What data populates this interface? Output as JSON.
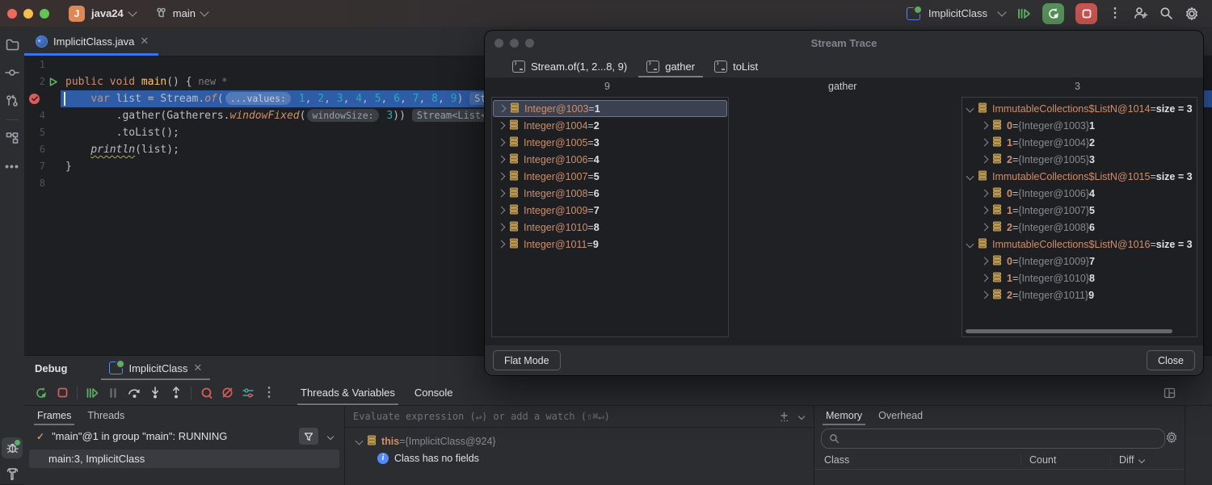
{
  "colors": {
    "accent": "#3574f0",
    "exec-line": "#2e5ca6",
    "orange": "#cf8e6d",
    "cyan": "#2aacb8",
    "green": "#5fad65",
    "red": "#db5c5c"
  },
  "titlebar": {
    "project": "java24",
    "branch": "main",
    "run_config": "ImplicitClass",
    "project_badge": "J"
  },
  "editor": {
    "tab_title": "ImplicitClass.java",
    "lines": [
      {
        "n": "1",
        "segs": []
      },
      {
        "n": "2",
        "run": true,
        "segs": [
          {
            "t": "public void ",
            "c": "kw"
          },
          {
            "t": "main",
            "c": "fn"
          },
          {
            "t": "() { ",
            "c": "pl"
          },
          {
            "t": "new *",
            "c": "hint"
          }
        ]
      },
      {
        "n": "3",
        "bp": true,
        "hl": true,
        "segs": [
          {
            "t": "    ",
            "c": "pl"
          },
          {
            "t": "var",
            "c": "kw"
          },
          {
            "t": " list = Stream.",
            "c": "pl"
          },
          {
            "t": "of",
            "c": "kwi"
          },
          {
            "t": "(",
            "c": "pl"
          },
          {
            "t": "...values:",
            "c": "pill"
          },
          {
            "t": " ",
            "c": "pl"
          },
          {
            "t": "1",
            "c": "num"
          },
          {
            "t": ", ",
            "c": "pl"
          },
          {
            "t": "2",
            "c": "num"
          },
          {
            "t": ", ",
            "c": "pl"
          },
          {
            "t": "3",
            "c": "num"
          },
          {
            "t": ", ",
            "c": "pl"
          },
          {
            "t": "4",
            "c": "num"
          },
          {
            "t": ", ",
            "c": "pl"
          },
          {
            "t": "5",
            "c": "num"
          },
          {
            "t": ", ",
            "c": "pl"
          },
          {
            "t": "6",
            "c": "num"
          },
          {
            "t": ", ",
            "c": "pl"
          },
          {
            "t": "7",
            "c": "num"
          },
          {
            "t": ", ",
            "c": "pl"
          },
          {
            "t": "8",
            "c": "num"
          },
          {
            "t": ", ",
            "c": "pl"
          },
          {
            "t": "9",
            "c": "num"
          },
          {
            "t": ") ",
            "c": "pl"
          },
          {
            "t": "Stream<Integer>",
            "c": "type"
          }
        ]
      },
      {
        "n": "4",
        "segs": [
          {
            "t": "        .gather(Gatherers.",
            "c": "pl"
          },
          {
            "t": "windowFixed",
            "c": "kwi"
          },
          {
            "t": "(",
            "c": "pl"
          },
          {
            "t": "windowSize:",
            "c": "pill"
          },
          {
            "t": " ",
            "c": "pl"
          },
          {
            "t": "3",
            "c": "num"
          },
          {
            "t": ")) ",
            "c": "pl"
          },
          {
            "t": "Stream<List<...>>",
            "c": "type"
          }
        ]
      },
      {
        "n": "5",
        "segs": [
          {
            "t": "        .toList();",
            "c": "pl"
          }
        ]
      },
      {
        "n": "6",
        "segs": [
          {
            "t": "    ",
            "c": "pl"
          },
          {
            "t": "println",
            "c": "warn"
          },
          {
            "t": "(list);",
            "c": "pl"
          }
        ]
      },
      {
        "n": "7",
        "segs": [
          {
            "t": "}",
            "c": "pl"
          }
        ]
      },
      {
        "n": "8",
        "segs": []
      }
    ]
  },
  "dialog": {
    "title": "Stream Trace",
    "tabs": [
      {
        "label": "Stream.of(1, 2...8, 9)"
      },
      {
        "label": "gather"
      },
      {
        "label": "toList"
      }
    ],
    "before_count": "9",
    "operation": "gather",
    "after_count": "3",
    "before": [
      {
        "name": "Integer@1003",
        "value": "1",
        "selected": true
      },
      {
        "name": "Integer@1004",
        "value": "2"
      },
      {
        "name": "Integer@1005",
        "value": "3"
      },
      {
        "name": "Integer@1006",
        "value": "4"
      },
      {
        "name": "Integer@1007",
        "value": "5"
      },
      {
        "name": "Integer@1008",
        "value": "6"
      },
      {
        "name": "Integer@1009",
        "value": "7"
      },
      {
        "name": "Integer@1010",
        "value": "8"
      },
      {
        "name": "Integer@1011",
        "value": "9"
      }
    ],
    "after": [
      {
        "name": "ImmutableCollections$ListN@1014",
        "value": "size = 3",
        "children": [
          {
            "index": "0",
            "ref": "{Integer@1003}",
            "value": "1"
          },
          {
            "index": "1",
            "ref": "{Integer@1004}",
            "value": "2"
          },
          {
            "index": "2",
            "ref": "{Integer@1005}",
            "value": "3"
          }
        ]
      },
      {
        "name": "ImmutableCollections$ListN@1015",
        "value": "size = 3",
        "children": [
          {
            "index": "0",
            "ref": "{Integer@1006}",
            "value": "4"
          },
          {
            "index": "1",
            "ref": "{Integer@1007}",
            "value": "5"
          },
          {
            "index": "2",
            "ref": "{Integer@1008}",
            "value": "6"
          }
        ]
      },
      {
        "name": "ImmutableCollections$ListN@1016",
        "value": "size = 3",
        "children": [
          {
            "index": "0",
            "ref": "{Integer@1009}",
            "value": "7"
          },
          {
            "index": "1",
            "ref": "{Integer@1010}",
            "value": "8"
          },
          {
            "index": "2",
            "ref": "{Integer@1011}",
            "value": "9"
          }
        ]
      }
    ],
    "flat_mode_label": "Flat Mode",
    "close_label": "Close"
  },
  "debug": {
    "title": "Debug",
    "session_tab": "ImplicitClass",
    "view_tabs": [
      {
        "label": "Threads & Variables"
      },
      {
        "label": "Console"
      }
    ],
    "frames": {
      "tabs": [
        {
          "label": "Frames"
        },
        {
          "label": "Threads"
        }
      ],
      "thread": "\"main\"@1 in group \"main\": RUNNING",
      "frame": "main:3, ImplicitClass"
    },
    "variables": {
      "placeholder": "Evaluate expression (↵) or add a watch (⇧⌘↵)",
      "this_name": "this",
      "this_eq": " = ",
      "this_value": "{ImplicitClass@924}",
      "info": "Class has no fields"
    },
    "memory": {
      "tabs": [
        {
          "label": "Memory"
        },
        {
          "label": "Overhead"
        }
      ],
      "columns": [
        "Class",
        "Count",
        "Diff"
      ]
    }
  }
}
